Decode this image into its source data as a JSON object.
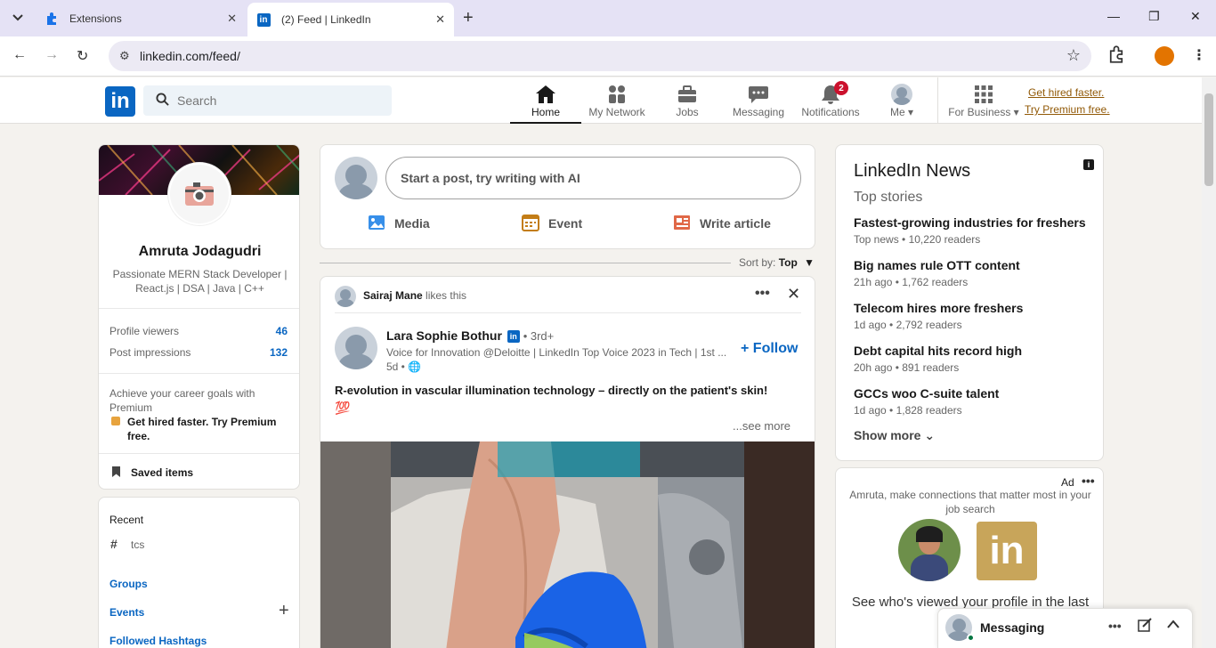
{
  "browser": {
    "tabs": [
      {
        "title": "Extensions",
        "active": false
      },
      {
        "title": "(2) Feed | LinkedIn",
        "active": true
      }
    ],
    "url": "linkedin.com/feed/"
  },
  "header": {
    "search_placeholder": "Search",
    "nav": {
      "home": "Home",
      "network": "My Network",
      "jobs": "Jobs",
      "messaging": "Messaging",
      "notifications": "Notifications",
      "notifications_count": "2",
      "me": "Me",
      "business": "For Business"
    },
    "premium_line1": "Get hired faster.",
    "premium_line2": "Try Premium free."
  },
  "profile": {
    "name": "Amruta Jodagudri",
    "headline": "Passionate MERN Stack Developer | React.js | DSA | Java | C++",
    "stats": [
      {
        "label": "Profile viewers",
        "value": "46"
      },
      {
        "label": "Post impressions",
        "value": "132"
      }
    ],
    "premium_prompt": "Achieve your career goals with Premium",
    "premium_cta": "Get hired faster. Try Premium free.",
    "saved": "Saved items"
  },
  "sidebar": {
    "recent_title": "Recent",
    "recent_item": "tcs",
    "groups": "Groups",
    "events": "Events",
    "hashtags": "Followed Hashtags"
  },
  "composer": {
    "placeholder": "Start a post, try writing with AI",
    "media": "Media",
    "event": "Event",
    "article": "Write article"
  },
  "sort": {
    "label": "Sort by:",
    "value": "Top"
  },
  "post": {
    "actor": "Sairaj Mane",
    "actor_action": "likes this",
    "author": "Lara Sophie Bothur",
    "degree": "• 3rd+",
    "author_headline": "Voice for Innovation @Deloitte | LinkedIn Top Voice 2023 in Tech | 1st ...",
    "time": "5d •",
    "follow": "Follow",
    "text": "R-evolution in vascular illumination technology – directly on the patient's skin!",
    "emoji": "💯",
    "see_more": "...see more"
  },
  "news": {
    "title": "LinkedIn News",
    "subtitle": "Top stories",
    "items": [
      {
        "headline": "Fastest-growing industries for freshers",
        "meta": "Top news • 10,220 readers"
      },
      {
        "headline": "Big names rule OTT content",
        "meta": "21h ago • 1,762 readers"
      },
      {
        "headline": "Telecom hires more freshers",
        "meta": "1d ago • 2,792 readers"
      },
      {
        "headline": "Debt capital hits record high",
        "meta": "20h ago • 891 readers"
      },
      {
        "headline": "GCCs woo C-suite talent",
        "meta": "1d ago • 1,828 readers"
      }
    ],
    "show_more": "Show more"
  },
  "ad": {
    "label": "Ad",
    "text": "Amruta, make connections that matter most in your job search",
    "footer": "See who's viewed your profile in the last"
  },
  "messaging": {
    "label": "Messaging"
  },
  "colors": {
    "brand": "#0a66c2",
    "premium": "#915907",
    "badge": "#cb112d"
  }
}
